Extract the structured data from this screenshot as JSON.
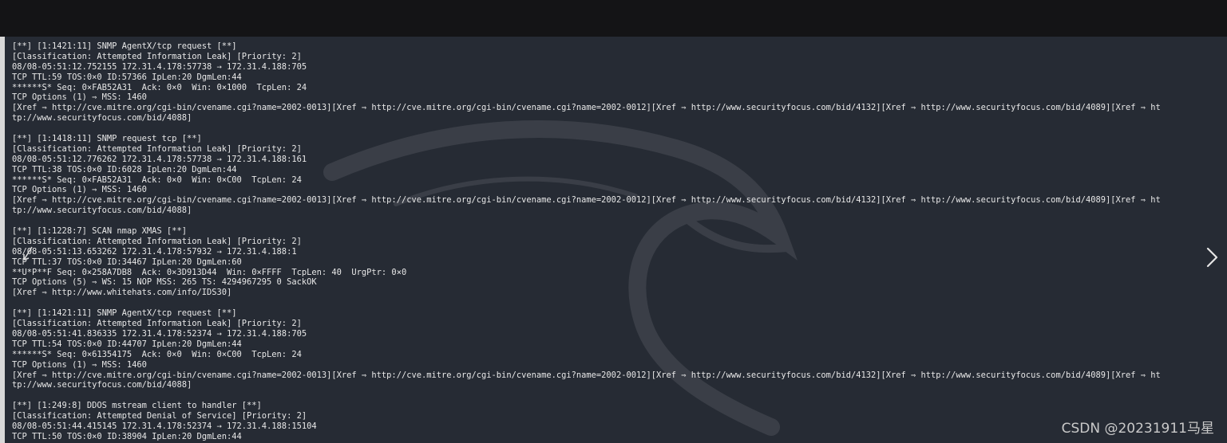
{
  "terminal": {
    "lines": [
      "[**] [1:1421:11] SNMP AgentX/tcp request [**]",
      "[Classification: Attempted Information Leak] [Priority: 2]",
      "08/08-05:51:12.752155 172.31.4.178:57738 → 172.31.4.188:705",
      "TCP TTL:59 TOS:0×0 ID:57366 IpLen:20 DgmLen:44",
      "******S* Seq: 0×FAB52A31  Ack: 0×0  Win: 0×1000  TcpLen: 24",
      "TCP Options (1) ⇒ MSS: 1460",
      "[Xref ⇒ http://cve.mitre.org/cgi-bin/cvename.cgi?name=2002-0013][Xref ⇒ http://cve.mitre.org/cgi-bin/cvename.cgi?name=2002-0012][Xref ⇒ http://www.securityfocus.com/bid/4132][Xref ⇒ http://www.securityfocus.com/bid/4089][Xref ⇒ ht",
      "tp://www.securityfocus.com/bid/4088]",
      "",
      "[**] [1:1418:11] SNMP request tcp [**]",
      "[Classification: Attempted Information Leak] [Priority: 2]",
      "08/08-05:51:12.776262 172.31.4.178:57738 → 172.31.4.188:161",
      "TCP TTL:38 TOS:0×0 ID:6028 IpLen:20 DgmLen:44",
      "******S* Seq: 0×FAB52A31  Ack: 0×0  Win: 0×C00  TcpLen: 24",
      "TCP Options (1) ⇒ MSS: 1460",
      "[Xref ⇒ http://cve.mitre.org/cgi-bin/cvename.cgi?name=2002-0013][Xref ⇒ http://cve.mitre.org/cgi-bin/cvename.cgi?name=2002-0012][Xref ⇒ http://www.securityfocus.com/bid/4132][Xref ⇒ http://www.securityfocus.com/bid/4089][Xref ⇒ ht",
      "tp://www.securityfocus.com/bid/4088]",
      "",
      "[**] [1:1228:7] SCAN nmap XMAS [**]",
      "[Classification: Attempted Information Leak] [Priority: 2]",
      "08/08-05:51:13.653262 172.31.4.178:57932 → 172.31.4.188:1",
      "TCP TTL:37 TOS:0×0 ID:34467 IpLen:20 DgmLen:60",
      "**U*P**F Seq: 0×258A7DB8  Ack: 0×3D913D44  Win: 0×FFFF  TcpLen: 40  UrgPtr: 0×0",
      "TCP Options (5) ⇒ WS: 15 NOP MSS: 265 TS: 4294967295 0 SackOK",
      "[Xref ⇒ http://www.whitehats.com/info/IDS30]",
      "",
      "[**] [1:1421:11] SNMP AgentX/tcp request [**]",
      "[Classification: Attempted Information Leak] [Priority: 2]",
      "08/08-05:51:41.836335 172.31.4.178:52374 → 172.31.4.188:705",
      "TCP TTL:54 TOS:0×0 ID:44707 IpLen:20 DgmLen:44",
      "******S* Seq: 0×61354175  Ack: 0×0  Win: 0×C00  TcpLen: 24",
      "TCP Options (1) ⇒ MSS: 1460",
      "[Xref ⇒ http://cve.mitre.org/cgi-bin/cvename.cgi?name=2002-0013][Xref ⇒ http://cve.mitre.org/cgi-bin/cvename.cgi?name=2002-0012][Xref ⇒ http://www.securityfocus.com/bid/4132][Xref ⇒ http://www.securityfocus.com/bid/4089][Xref ⇒ ht",
      "tp://www.securityfocus.com/bid/4088]",
      "",
      "[**] [1:249:8] DDOS mstream client to handler [**]",
      "[Classification: Attempted Denial of Service] [Priority: 2]",
      "08/08-05:51:44.415145 172.31.4.178:52374 → 172.31.4.188:15104",
      "TCP TTL:50 TOS:0×0 ID:38904 IpLen:20 DgmLen:44"
    ]
  },
  "watermark": "CSDN @20231911马星",
  "icons": {
    "next": "chevron-right-icon",
    "cursor": "mouse-cursor-icon",
    "background": "kali-dragon-icon"
  },
  "colors": {
    "terminal_bg": "#262b34",
    "text": "#e8e8e8",
    "topbar": "#141416"
  }
}
